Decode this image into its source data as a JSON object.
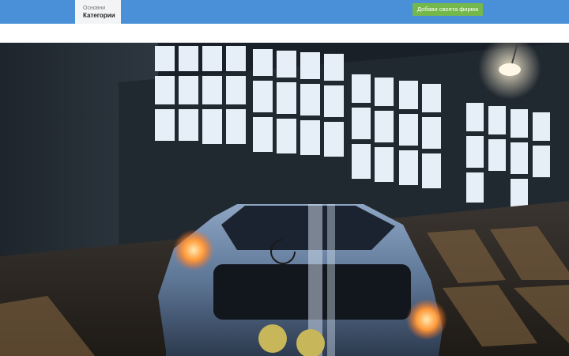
{
  "header": {
    "categories_line1": "Основни",
    "categories_line2": "Категории",
    "add_company_label": "Добави своята фирма"
  },
  "colors": {
    "topbar": "#4a90d9",
    "add_button": "#74b84c"
  },
  "hero": {
    "image": "garage-car-photo",
    "loading_indicator": "spinner-icon"
  }
}
